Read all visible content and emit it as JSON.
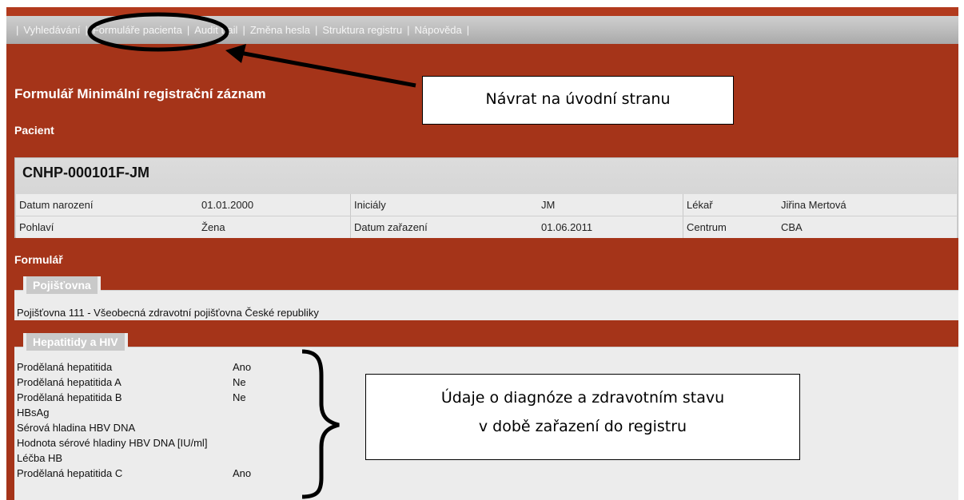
{
  "nav": {
    "items": [
      "Vyhledávání",
      "Formuláře pacienta",
      "Audit trail",
      "Změna hesla",
      "Struktura registru",
      "Nápověda"
    ],
    "separator": "|"
  },
  "page_title": "Formulář Minimální registrační záznam",
  "section_patient": "Pacient",
  "patient": {
    "id": "CNHP-000101F-JM",
    "row1": [
      {
        "label": "Datum narození",
        "value": "01.01.2000"
      },
      {
        "label": "Iniciály",
        "value": "JM"
      },
      {
        "label": "Lékař",
        "value": "Jiřina Mertová"
      }
    ],
    "row2": [
      {
        "label": "Pohlaví",
        "value": "Žena"
      },
      {
        "label": "Datum zařazení",
        "value": "01.06.2011"
      },
      {
        "label": "Centrum",
        "value": "CBA"
      }
    ]
  },
  "section_form": "Formulář",
  "insurance": {
    "legend": "Pojišťovna",
    "value": "Pojišťovna 111 - Všeobecná zdravotní pojišťovna České republiky"
  },
  "hepatitis": {
    "legend": "Hepatitidy a HIV",
    "rows": [
      {
        "label": "Prodělaná hepatitida",
        "value": "Ano"
      },
      {
        "label": "Prodělaná hepatitida A",
        "value": "Ne"
      },
      {
        "label": "Prodělaná hepatitida B",
        "value": "Ne"
      },
      {
        "label": "HBsAg",
        "value": ""
      },
      {
        "label": "Sérová hladina HBV DNA",
        "value": ""
      },
      {
        "label": "Hodnota sérové hladiny HBV DNA [IU/ml]",
        "value": ""
      },
      {
        "label": "Léčba HB",
        "value": ""
      },
      {
        "label": "Prodělaná hepatitida C",
        "value": "Ano"
      }
    ]
  },
  "callouts": {
    "home": "Návrat na úvodní stranu",
    "diagnosis_line1": "Údaje o diagnóze a  zdravotním stavu",
    "diagnosis_line2": "v době zařazení do registru"
  }
}
